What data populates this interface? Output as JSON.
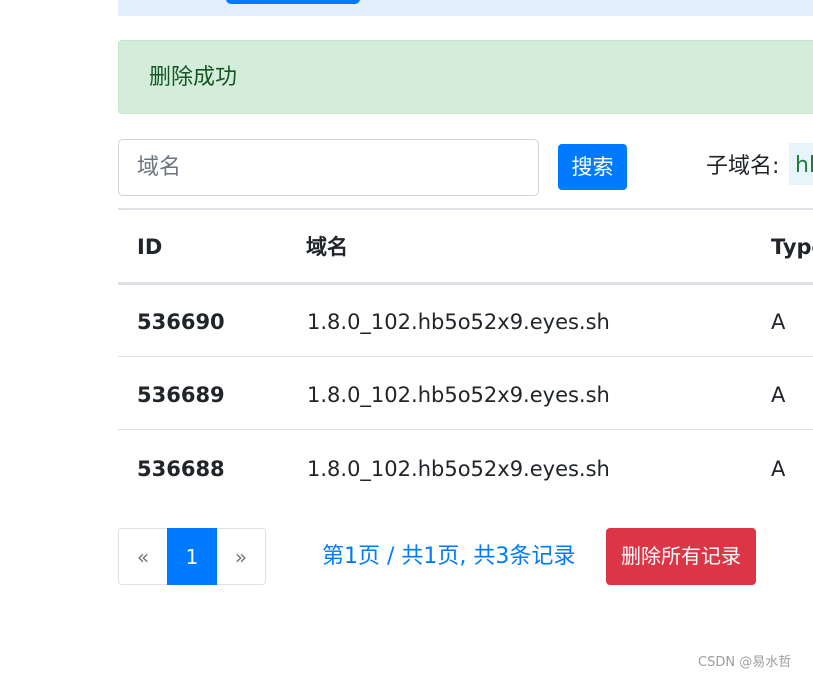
{
  "alert": {
    "message": "删除成功"
  },
  "search": {
    "placeholder": "域名",
    "value": "",
    "button_label": "搜索"
  },
  "subdomain": {
    "label": "子域名:",
    "value": "hb"
  },
  "table": {
    "headers": {
      "id": "ID",
      "domain": "域名",
      "type": "Type"
    },
    "rows": [
      {
        "id": "536690",
        "domain": "1.8.0_102.hb5o52x9.eyes.sh",
        "type": "A"
      },
      {
        "id": "536689",
        "domain": "1.8.0_102.hb5o52x9.eyes.sh",
        "type": "A"
      },
      {
        "id": "536688",
        "domain": "1.8.0_102.hb5o52x9.eyes.sh",
        "type": "A"
      }
    ]
  },
  "pagination": {
    "prev": "«",
    "current": "1",
    "next": "»"
  },
  "page_info": "第1页 / 共1页, 共3条记录",
  "delete_all_label": "删除所有记录",
  "watermark": "CSDN @易水哲",
  "colors": {
    "primary": "#007bff",
    "danger": "#dc3545",
    "success_bg": "#d4edda"
  }
}
